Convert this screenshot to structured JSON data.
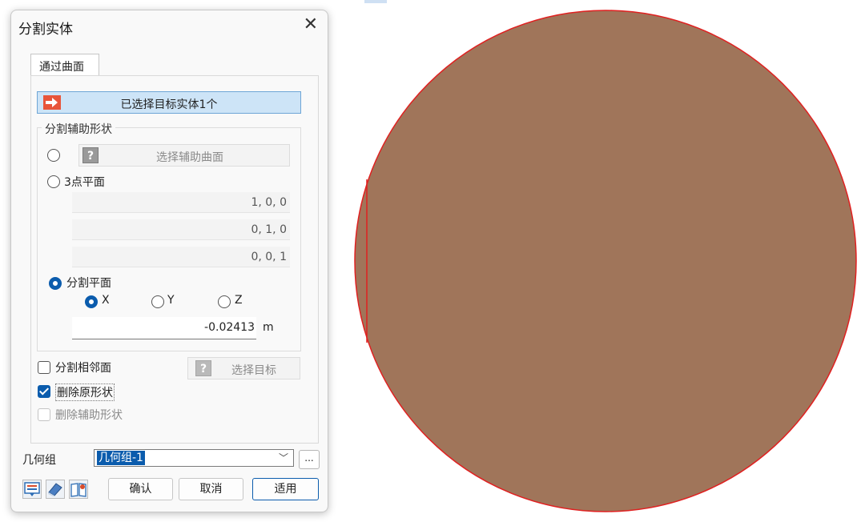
{
  "dialog": {
    "title": "分割实体",
    "close_glyph": "✕",
    "tab_label": "通过曲面",
    "target_button": "已选择目标实体1个",
    "group_legend": "分割辅助形状",
    "surface_button": "选择辅助曲面",
    "three_point_label": "3点平面",
    "coords": [
      "1, 0, 0",
      "0, 1, 0",
      "0, 0, 1"
    ],
    "split_plane_label": "分割平面",
    "axis_x": "X",
    "axis_y": "Y",
    "axis_z": "Z",
    "selected_axis": "X",
    "offset_value": "-0.02413",
    "offset_unit": "m",
    "split_adjacent_label": "分割相邻面",
    "split_adjacent_checked": false,
    "select_target_label": "选择目标",
    "delete_original_label": "删除原形状",
    "delete_original_checked": true,
    "delete_aux_label": "删除辅助形状",
    "delete_aux_checked": false,
    "geometry_group_label": "几何组",
    "geometry_group_value": "几何组-1",
    "more_label": "...",
    "ok_label": "确认",
    "cancel_label": "取消",
    "apply_label": "适用"
  },
  "colors": {
    "shape_fill": "#a0755a",
    "shape_edge": "#e02020",
    "accent": "#0b5cad",
    "target_button_bg": "#cde4f7"
  }
}
